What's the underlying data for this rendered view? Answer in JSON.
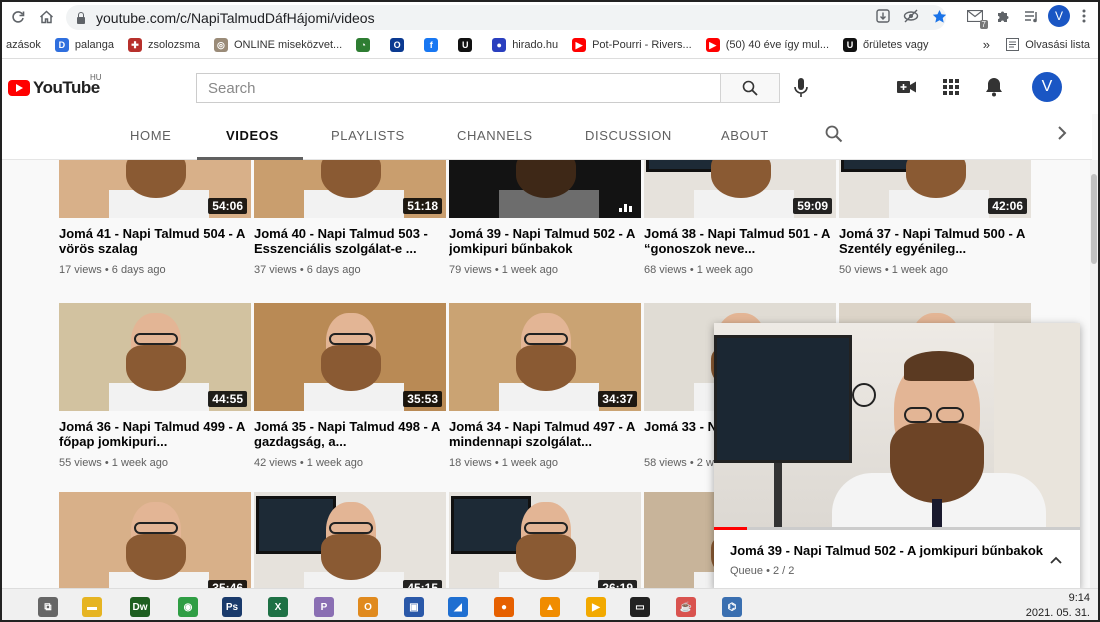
{
  "browser": {
    "url": "youtube.com/c/NapiTalmudDáfHájomi/videos",
    "profile_initial": "V",
    "icons": [
      "reload-icon",
      "home-icon",
      "lock-icon",
      "download-icon",
      "eye-off-icon",
      "star-icon",
      "gmail-icon",
      "puzzle-icon",
      "playlist-icon",
      "kebab-menu-icon"
    ],
    "mail_badge": "7",
    "bookmarks": [
      {
        "label": "azások",
        "color": "#ffffff"
      },
      {
        "label": "palanga",
        "color": "#2f6fde",
        "glyph": "D"
      },
      {
        "label": "zsolozsma",
        "color": "#b7302c",
        "glyph": "✚"
      },
      {
        "label": "ONLINE miseközvet...",
        "color": "#9a8b78",
        "glyph": "◎"
      },
      {
        "label": "",
        "color": "#2e7d32",
        "glyph": "◔"
      },
      {
        "label": "",
        "color": "#0b3a91",
        "glyph": "O"
      },
      {
        "label": "",
        "color": "#1877f2",
        "glyph": "f"
      },
      {
        "label": "",
        "color": "#111111",
        "glyph": "U"
      },
      {
        "label": "hirado.hu",
        "color": "#2a3fbf",
        "glyph": "●"
      },
      {
        "label": "Pot-Pourri - Rivers...",
        "color": "#ff0000",
        "glyph": "▶"
      },
      {
        "label": "(50) 40 éve így mul...",
        "color": "#ff0000",
        "glyph": "▶"
      },
      {
        "label": "őrületes vagy",
        "color": "#111111",
        "glyph": "U"
      }
    ],
    "bookmarks_more": "»",
    "reading_list": "Olvasási lista"
  },
  "youtube": {
    "logo_text": "YouTube",
    "region": "HU",
    "search_placeholder": "Search",
    "avatar_initial": "V",
    "tabs": [
      {
        "label": "HOME",
        "active": false
      },
      {
        "label": "VIDEOS",
        "active": true
      },
      {
        "label": "PLAYLISTS",
        "active": false
      },
      {
        "label": "CHANNELS",
        "active": false
      },
      {
        "label": "DISCUSSION",
        "active": false
      },
      {
        "label": "ABOUT",
        "active": false
      }
    ]
  },
  "videos": [
    {
      "title": "Jomá 41 - Napi Talmud 504 - A vörös szalag",
      "views": "17 views",
      "age": "6 days ago",
      "duration": "54:06"
    },
    {
      "title": "Jomá 40 - Napi Talmud 503 - Esszenciális szolgálat-e ...",
      "views": "37 views",
      "age": "6 days ago",
      "duration": "51:18"
    },
    {
      "title": "Jomá 39 - Napi Talmud 502 - A jomkipuri bűnbakok",
      "views": "79 views",
      "age": "1 week ago",
      "duration": "",
      "now_playing": "NOW PLAYING"
    },
    {
      "title": "Jomá 38 - Napi Talmud 501 - A “gonoszok neve...",
      "views": "68 views",
      "age": "1 week ago",
      "duration": "59:09"
    },
    {
      "title": "Jomá 37 - Napi Talmud 500 - A Szentély egyénileg...",
      "views": "50 views",
      "age": "1 week ago",
      "duration": "42:06"
    },
    {
      "title": "Jomá 36 - Napi Talmud 499 - A főpap jomkipuri...",
      "views": "55 views",
      "age": "1 week ago",
      "duration": "44:55"
    },
    {
      "title": "Jomá 35 - Napi Talmud 498 - A gazdagság, a...",
      "views": "42 views",
      "age": "1 week ago",
      "duration": "35:53"
    },
    {
      "title": "Jomá 34 - Napi Talmud 497 - A mindennapi szolgálat...",
      "views": "18 views",
      "age": "1 week ago",
      "duration": "34:37"
    },
    {
      "title": "Jomá 33 - N... - Mi volt a s...",
      "views": "58 views",
      "age": "2 w...",
      "duration": ""
    },
    {
      "title": "",
      "views": "",
      "age": "",
      "duration": ""
    },
    {
      "title": "",
      "views": "",
      "age": "",
      "duration": "35:46"
    },
    {
      "title": "",
      "views": "",
      "age": "",
      "duration": "45:15"
    },
    {
      "title": "",
      "views": "",
      "age": "",
      "duration": "26:19"
    },
    {
      "title": "",
      "views": "",
      "age": "",
      "duration": ""
    }
  ],
  "miniplayer": {
    "title": "Jomá 39 - Napi Talmud 502 - A jomkipuri bűnbakok",
    "queue": "Queue • 2 / 2",
    "progress_fraction": 0.09
  },
  "taskbar": {
    "time": "9:14",
    "date": "2021. 05. 31."
  }
}
